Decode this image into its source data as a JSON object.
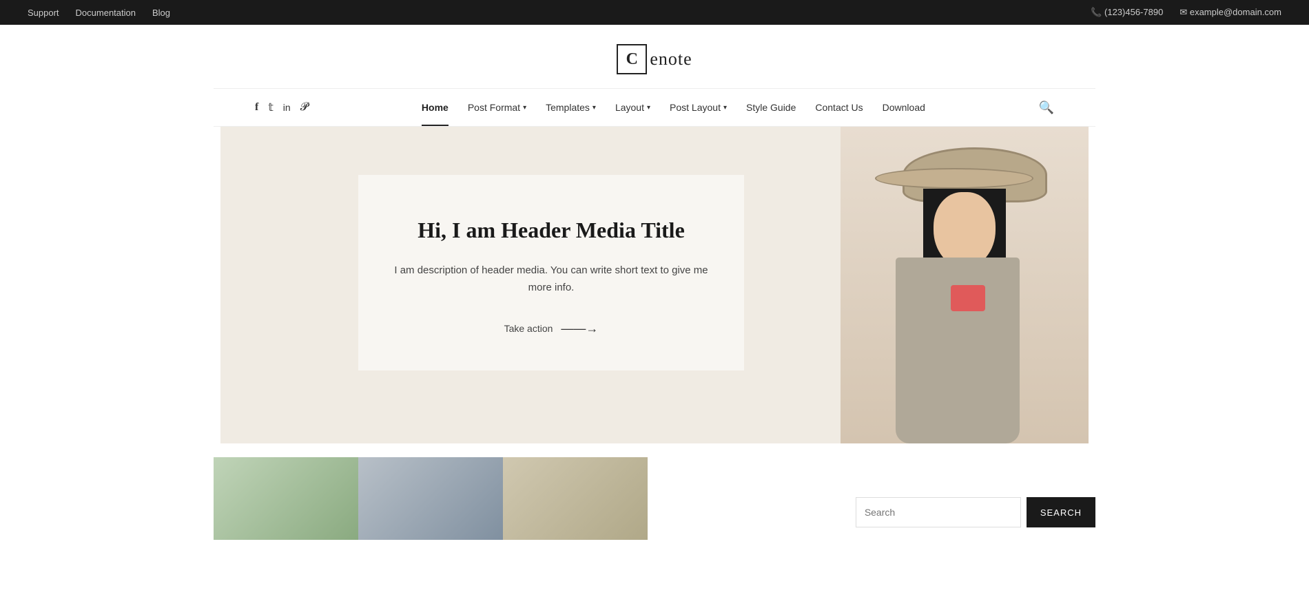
{
  "topbar": {
    "left": {
      "links": [
        {
          "label": "Support",
          "name": "support-link"
        },
        {
          "label": "Documentation",
          "name": "documentation-link"
        },
        {
          "label": "Blog",
          "name": "blog-link"
        }
      ]
    },
    "right": {
      "phone": "(123)456-7890",
      "email": "example@domain.com"
    }
  },
  "logo": {
    "letter": "C",
    "text": "enote"
  },
  "nav": {
    "items": [
      {
        "label": "Home",
        "active": true,
        "hasDropdown": false
      },
      {
        "label": "Post Format",
        "active": false,
        "hasDropdown": true
      },
      {
        "label": "Templates",
        "active": false,
        "hasDropdown": true
      },
      {
        "label": "Layout",
        "active": false,
        "hasDropdown": true
      },
      {
        "label": "Post Layout",
        "active": false,
        "hasDropdown": true
      },
      {
        "label": "Style Guide",
        "active": false,
        "hasDropdown": false
      },
      {
        "label": "Contact Us",
        "active": false,
        "hasDropdown": false
      },
      {
        "label": "Download",
        "active": false,
        "hasDropdown": false
      }
    ]
  },
  "social": {
    "icons": [
      {
        "name": "facebook-icon",
        "symbol": "f"
      },
      {
        "name": "twitter-icon",
        "symbol": "t"
      },
      {
        "name": "linkedin-icon",
        "symbol": "in"
      },
      {
        "name": "pinterest-icon",
        "symbol": "p"
      }
    ]
  },
  "hero": {
    "title": "Hi, I am Header Media Title",
    "description": "I am description of header media. You can write short text to give me more info.",
    "cta_label": "Take action",
    "cta_arrow": "——→"
  },
  "search": {
    "placeholder": "Search",
    "button_label": "SEARCH"
  }
}
